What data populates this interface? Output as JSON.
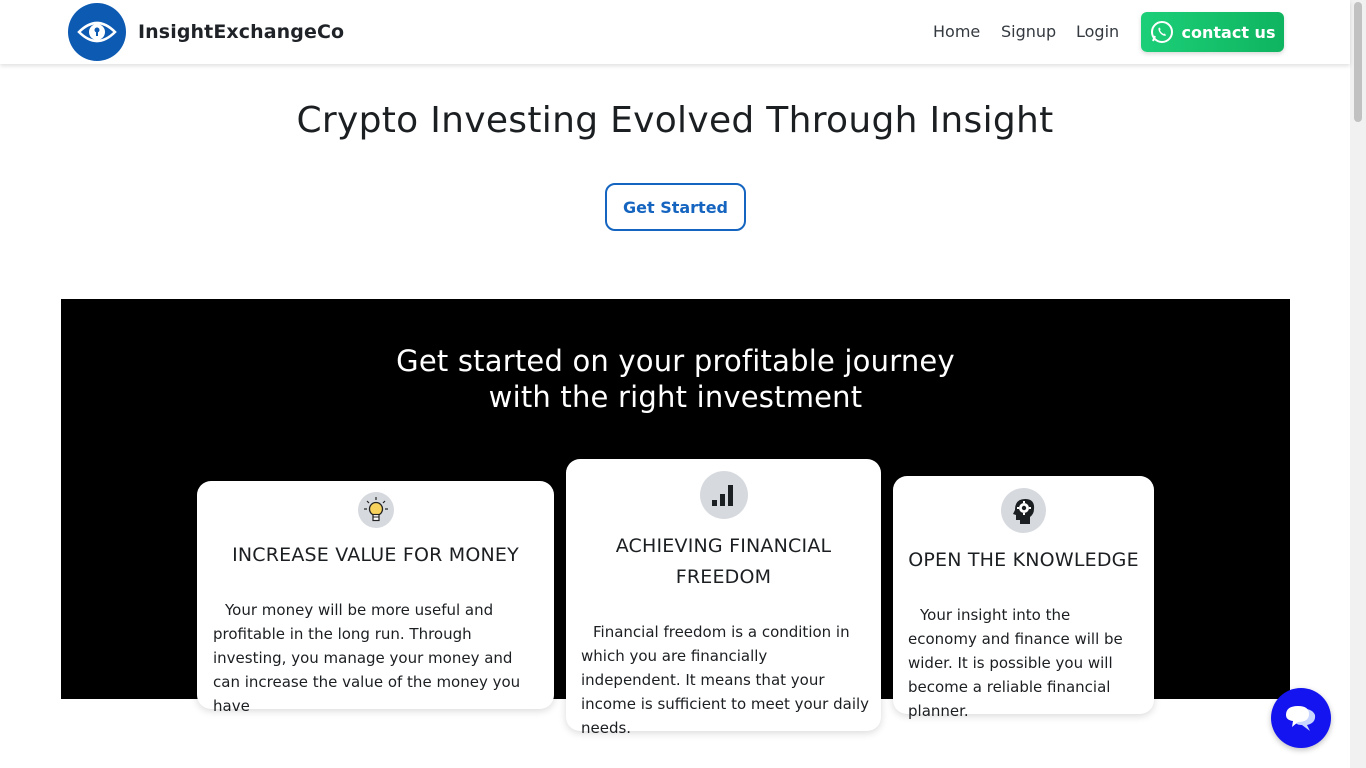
{
  "header": {
    "brand_name": "InsightExchangeCo",
    "nav": {
      "home": "Home",
      "signup": "Signup",
      "login": "Login"
    },
    "contact_label": "contact us"
  },
  "hero": {
    "title": "Crypto Investing Evolved Through Insight",
    "cta_label": "Get Started"
  },
  "features": {
    "title_line1": "Get started on your profitable journey",
    "title_line2": "with the right investment",
    "cards": [
      {
        "icon": "lightbulb-icon",
        "title": "INCREASE VALUE FOR MONEY",
        "text": "Your money will be more useful and profitable in the long run. Through investing, you manage your money and can increase the value of the money you have"
      },
      {
        "icon": "bar-chart-icon",
        "title_line1": "ACHIEVING FINANCIAL",
        "title_line2": "FREEDOM",
        "text": "Financial freedom is a condition in which you are financially independent. It means that your income is sufficient to meet your daily needs."
      },
      {
        "icon": "head-gear-icon",
        "title": "OPEN THE KNOWLEDGE",
        "text": "Your insight into the economy and finance will be wider. It is possible you will become a reliable financial planner."
      }
    ]
  },
  "colors": {
    "brand_blue": "#0d5ab3",
    "whatsapp_green": "#19c26f",
    "cta_blue": "#1565c0",
    "chat_blue": "#1414f0",
    "section_bg": "#000000"
  },
  "chat_icon": "chat-bubbles-icon"
}
